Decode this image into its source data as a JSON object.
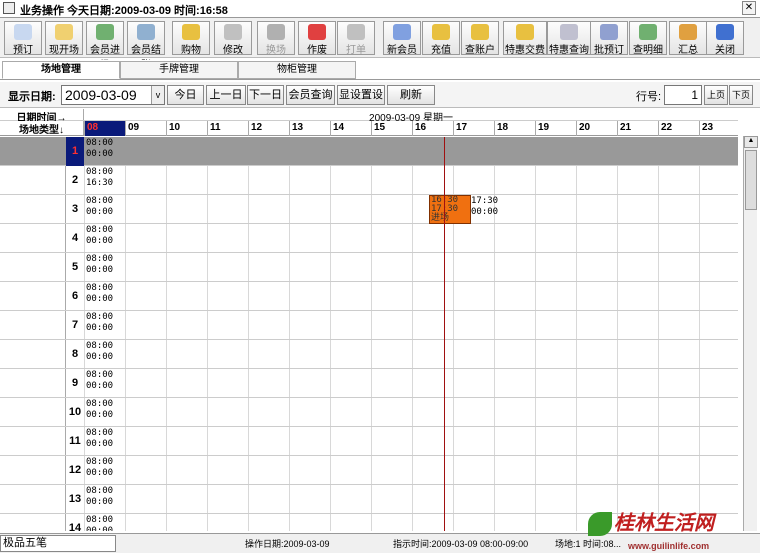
{
  "window": {
    "title": "业务操作  今天日期:2009-03-09 时间:16:58",
    "close": "✕"
  },
  "toolbar": [
    {
      "label": "预订",
      "icon": "document-icon",
      "color": "#c8d8f0"
    },
    {
      "label": "现开场",
      "icon": "document-star-icon",
      "color": "#f0d070"
    },
    {
      "label": "会员进场",
      "icon": "member-enter-icon",
      "color": "#70b070"
    },
    {
      "label": "会员结账",
      "icon": "member-checkout-icon",
      "color": "#90b0d0"
    },
    {
      "label": "购物",
      "icon": "shopping-icon",
      "color": "#e8c040"
    },
    {
      "label": "修改",
      "icon": "edit-icon",
      "color": "#c0c0c0"
    },
    {
      "label": "换场",
      "icon": "swap-icon",
      "color": "#b0b0b0"
    },
    {
      "label": "作废",
      "icon": "cancel-x-icon",
      "color": "#e04040"
    },
    {
      "label": "打单",
      "icon": "printer-icon",
      "color": "#c0c0c0"
    },
    {
      "label": "新会员",
      "icon": "new-member-icon",
      "color": "#80a0e0"
    },
    {
      "label": "充值",
      "icon": "recharge-icon",
      "color": "#e8c040"
    },
    {
      "label": "查账户",
      "icon": "account-icon",
      "color": "#e8c040"
    },
    {
      "label": "特惠交费",
      "icon": "discount-pay-icon",
      "color": "#e8c040"
    },
    {
      "label": "特惠查询",
      "icon": "discount-query-icon",
      "color": "#c0c0d0"
    },
    {
      "label": "批预订",
      "icon": "batch-booking-icon",
      "color": "#90a0d0"
    },
    {
      "label": "查明细",
      "icon": "detail-icon",
      "color": "#70b070"
    },
    {
      "label": "汇总",
      "icon": "summary-icon",
      "color": "#e0a040"
    },
    {
      "label": "关闭",
      "icon": "close-arrow-icon",
      "color": "#4070d0"
    }
  ],
  "tabs": [
    "场地管理",
    "手牌管理",
    "物柜管理"
  ],
  "datebar": {
    "label": "显示日期:",
    "date": "2009-03-09",
    "dropdown": "v",
    "buttons": [
      "今日",
      "上一日",
      "下一日",
      "会员查询",
      "显设置设",
      "刷新"
    ],
    "row_label": "行号:",
    "row_value": "1",
    "prev_page": "上页",
    "next_page": "下页"
  },
  "grid": {
    "header_date_label": "日期时间→",
    "header_type_label": "场地类型↓",
    "date_text": "2009-03-09  星期一",
    "hours": [
      "08",
      "09",
      "10",
      "11",
      "12",
      "13",
      "14",
      "15",
      "16",
      "17",
      "18",
      "19",
      "20",
      "21",
      "22",
      "23"
    ],
    "rows": [
      {
        "num": "1",
        "t1": "08:00",
        "t2": "00:00"
      },
      {
        "num": "2",
        "t1": "08:00",
        "t2": "16:30"
      },
      {
        "num": "3",
        "t1": "08:00",
        "t2": "00:00"
      },
      {
        "num": "4",
        "t1": "08:00",
        "t2": "00:00"
      },
      {
        "num": "5",
        "t1": "08:00",
        "t2": "00:00"
      },
      {
        "num": "6",
        "t1": "08:00",
        "t2": "00:00"
      },
      {
        "num": "7",
        "t1": "08:00",
        "t2": "00:00"
      },
      {
        "num": "8",
        "t1": "08:00",
        "t2": "00:00"
      },
      {
        "num": "9",
        "t1": "08:00",
        "t2": "00:00"
      },
      {
        "num": "10",
        "t1": "08:00",
        "t2": "00:00"
      },
      {
        "num": "11",
        "t1": "08:00",
        "t2": "00:00"
      },
      {
        "num": "12",
        "t1": "08:00",
        "t2": "00:00"
      },
      {
        "num": "13",
        "t1": "08:00",
        "t2": "00:00"
      },
      {
        "num": "14",
        "t1": "08:00",
        "t2": "00:00"
      }
    ],
    "booking": {
      "l1": "16:30",
      "l2": "17:30",
      "l3": "进场",
      "r1": "17:30",
      "r2": "00:00"
    }
  },
  "statusbar": {
    "ime": "极品五笔",
    "op_date": "操作日期:2009-03-09",
    "indicator": "指示时间:2009-03-09 08:00-09:00",
    "field": "场地:1 时间:08..."
  },
  "watermark": {
    "text": "桂林生活网",
    "url": "www.guilinlife.com"
  }
}
